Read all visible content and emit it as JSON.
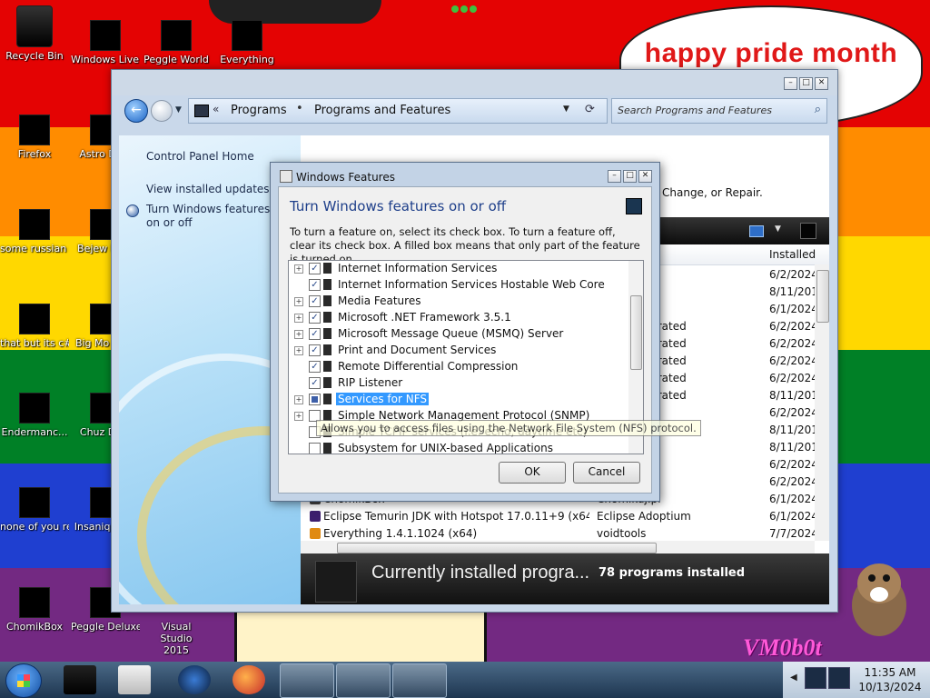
{
  "desktop": {
    "banner_text": "happy pride month",
    "watermark": "VM0b0t",
    "icons": [
      {
        "label": "Recycle Bin"
      },
      {
        "label": "Windows Live Ma..."
      },
      {
        "label": "Peggle World"
      },
      {
        "label": "Everything"
      },
      {
        "label": "Firefox"
      },
      {
        "label": "Astro Delu"
      },
      {
        "label": "some russian ran a rat"
      },
      {
        "label": "Bejew Delu"
      },
      {
        "label": "that but its c#"
      },
      {
        "label": "Big Mo Delu"
      },
      {
        "label": "Endermanc..."
      },
      {
        "label": "Chuz Delu"
      },
      {
        "label": "none of you retards kno..."
      },
      {
        "label": "Insaniq Delu"
      },
      {
        "label": "ChomikBox"
      },
      {
        "label": "Peggle Deluxe"
      },
      {
        "label": "Visual Studio 2015"
      }
    ]
  },
  "programs_window": {
    "breadcrumb": [
      "Programs",
      "Programs and Features"
    ],
    "search_placeholder": "Search Programs and Features",
    "left_links": {
      "home": "Control Panel Home",
      "updates": "View installed updates",
      "features": "Turn Windows features on or off"
    },
    "hint": "Change, or Repair.",
    "columns": {
      "installed": "Installed"
    },
    "rows": [
      {
        "name": "",
        "publisher": "",
        "installed": "6/2/2024"
      },
      {
        "name": "",
        "publisher": "",
        "installed": "8/11/2017"
      },
      {
        "name": "",
        "publisher": "",
        "installed": "6/1/2024"
      },
      {
        "name": "",
        "publisher": "ms Incorporated",
        "installed": "6/2/2024"
      },
      {
        "name": "",
        "publisher": "ms Incorporated",
        "installed": "6/2/2024"
      },
      {
        "name": "",
        "publisher": "ms Incorporated",
        "installed": "6/2/2024"
      },
      {
        "name": "",
        "publisher": "ms Incorporated",
        "installed": "6/2/2024"
      },
      {
        "name": "",
        "publisher": "ms Incorporated",
        "installed": "8/11/2017"
      },
      {
        "name": "",
        "publisher": "ms, Inc.",
        "installed": "6/2/2024"
      },
      {
        "name": "",
        "publisher": "",
        "installed": "8/11/2017"
      },
      {
        "name": "",
        "publisher": "",
        "installed": "8/11/2017"
      },
      {
        "name": "",
        "publisher": "ork",
        "installed": "6/2/2024"
      },
      {
        "name": "",
        "publisher": "",
        "installed": "6/2/2024"
      },
      {
        "name": "ChomikBox",
        "publisher": "Chomikuj.pl",
        "installed": "6/1/2024"
      },
      {
        "name": "Eclipse Temurin JDK with Hotspot 17.0.11+9 (x64)",
        "publisher": "Eclipse Adoptium",
        "installed": "6/1/2024"
      },
      {
        "name": "Everything 1.4.1.1024 (x64)",
        "publisher": "voidtools",
        "installed": "7/7/2024"
      }
    ],
    "details": {
      "title": "Currently installed progra...",
      "count": "78 programs installed"
    }
  },
  "features_dialog": {
    "title": "Windows Features",
    "heading": "Turn Windows features on or off",
    "description": "To turn a feature on, select its check box. To turn a feature off, clear its check box. A filled box means that only part of the feature is turned on.",
    "features": [
      {
        "label": "Internet Information Services",
        "expand": true,
        "state": "checked"
      },
      {
        "label": "Internet Information Services Hostable Web Core",
        "expand": false,
        "state": "checked"
      },
      {
        "label": "Media Features",
        "expand": true,
        "state": "checked"
      },
      {
        "label": "Microsoft .NET Framework 3.5.1",
        "expand": true,
        "state": "checked"
      },
      {
        "label": "Microsoft Message Queue (MSMQ) Server",
        "expand": true,
        "state": "checked"
      },
      {
        "label": "Print and Document Services",
        "expand": true,
        "state": "checked"
      },
      {
        "label": "Remote Differential Compression",
        "expand": false,
        "state": "checked"
      },
      {
        "label": "RIP Listener",
        "expand": false,
        "state": "checked"
      },
      {
        "label": "Services for NFS",
        "expand": true,
        "state": "partial"
      },
      {
        "label": "Simple Network Management Protocol (SNMP)",
        "expand": true,
        "state": "unchecked"
      },
      {
        "label": "Simple TCPIP services (i.e. echo, daytime etc)",
        "expand": false,
        "state": "unchecked"
      },
      {
        "label": "Subsystem for UNIX-based Applications",
        "expand": false,
        "state": "unchecked"
      }
    ],
    "tooltip": "Allows you to access files using the Network File System (NFS) protocol.",
    "ok_label": "OK",
    "cancel_label": "Cancel"
  },
  "taskbar": {
    "time": "11:35 AM",
    "date": "10/13/2024"
  }
}
